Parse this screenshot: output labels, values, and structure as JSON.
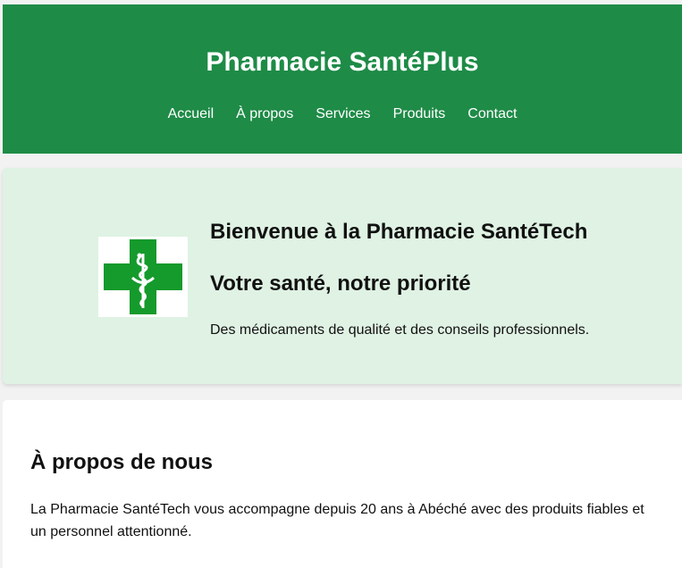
{
  "header": {
    "title": "Pharmacie SantéPlus",
    "nav": [
      {
        "label": "Accueil"
      },
      {
        "label": "À propos"
      },
      {
        "label": "Services"
      },
      {
        "label": "Produits"
      },
      {
        "label": "Contact"
      }
    ]
  },
  "hero": {
    "logo_icon": "pharmacy-cross-caduceus-icon",
    "title": "Bienvenue à la Pharmacie SantéTech",
    "subtitle": "Votre santé, notre priorité",
    "text": "Des médicaments de qualité et des conseils professionnels."
  },
  "about": {
    "title": "À propos de nous",
    "text": "La Pharmacie SantéTech vous accompagne depuis 20 ans à Abéché avec des produits fiables et un personnel attentionné."
  },
  "colors": {
    "header_bg": "#1e8b47",
    "hero_bg": "#dff2e3",
    "cross_green": "#159a2c",
    "page_bg": "#f2f2f2"
  }
}
